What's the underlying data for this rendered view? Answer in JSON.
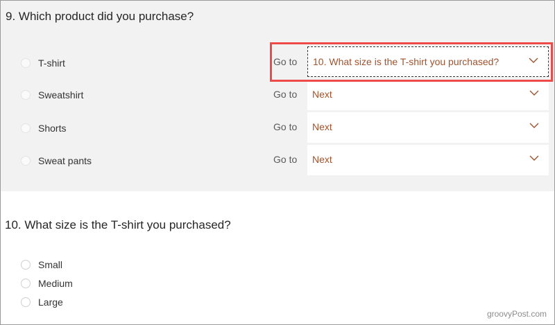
{
  "question9": {
    "title": "9. Which product did you purchase?",
    "goto_label": "Go to",
    "options": [
      {
        "label": "T-shirt",
        "branch": "10. What size is the T-shirt you purchased?"
      },
      {
        "label": "Sweatshirt",
        "branch": "Next"
      },
      {
        "label": "Shorts",
        "branch": "Next"
      },
      {
        "label": "Sweat pants",
        "branch": "Next"
      }
    ]
  },
  "question10": {
    "title": "10. What size is the T-shirt you purchased?",
    "options": [
      "Small",
      "Medium",
      "Large"
    ]
  },
  "highlight_color": "#ef4a4a",
  "watermark": "groovyPost.com"
}
